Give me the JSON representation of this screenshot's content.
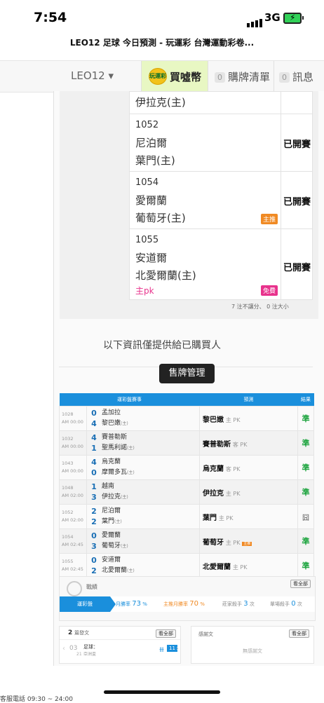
{
  "status": {
    "time": "7:54",
    "network": "3G"
  },
  "browser": {
    "title": "LEO12 足球 今日預測 - 玩運彩 台灣運動彩卷..."
  },
  "nav": {
    "user": "LEO12 ▾",
    "coin_icon_text": "玩運彩",
    "buy": "買噓幣",
    "cart_count": "0",
    "cart": "購牌清單",
    "msg_count": "0",
    "msg": "訊息"
  },
  "picks": {
    "top_partial": "伊拉克(主)",
    "rows": [
      {
        "no": "1052",
        "away": "尼泊爾",
        "home": "葉門(主)",
        "result": "已開賽",
        "extra": "",
        "tag": ""
      },
      {
        "no": "1054",
        "away": "愛爾蘭",
        "home": "葡萄牙(主)",
        "result": "已開賽",
        "extra": "",
        "tag": "主推"
      },
      {
        "no": "1055",
        "away": "安道爾",
        "home": "北愛爾蘭(主)",
        "result": "已開賽",
        "extra": "主pk",
        "tag": "免費"
      }
    ],
    "note": "7 注不讓分、 0 注大小"
  },
  "info_text": "以下資訊僅提供給已購買人",
  "manage_button": "售牌管理",
  "record": {
    "headers": [
      "運彩盤賽事",
      "預測",
      "結果"
    ],
    "rows": [
      {
        "no": "1028",
        "time": "AM 00:00",
        "s1": "0",
        "s2": "4",
        "t1": "孟加拉",
        "t2": "黎巴嫩",
        "home": "(主)",
        "pick": "黎巴嫩",
        "mk": "主 PK",
        "res": "準"
      },
      {
        "no": "1032",
        "time": "AM 00:00",
        "s1": "4",
        "s2": "1",
        "t1": "賽普勒斯",
        "t2": "聖馬利諾",
        "home": "(主)",
        "pick": "賽普勒斯",
        "mk": "客 PK",
        "res": "準"
      },
      {
        "no": "1043",
        "time": "AM 00:00",
        "s1": "4",
        "s2": "0",
        "t1": "烏克蘭",
        "t2": "摩爾多瓦",
        "home": "(主)",
        "pick": "烏克蘭",
        "mk": "客 PK",
        "res": "準"
      },
      {
        "no": "1048",
        "time": "AM 02:00",
        "s1": "1",
        "s2": "3",
        "t1": "越南",
        "t2": "伊拉克",
        "home": "(主)",
        "pick": "伊拉克",
        "mk": "主 PK",
        "res": "準"
      },
      {
        "no": "1052",
        "time": "AM 02:00",
        "s1": "2",
        "s2": "2",
        "t1": "尼泊爾",
        "t2": "葉門",
        "home": "(主)",
        "pick": "葉門",
        "mk": "主 PK",
        "res": "囧"
      },
      {
        "no": "1054",
        "time": "AM 02:45",
        "s1": "0",
        "s2": "3",
        "t1": "愛爾蘭",
        "t2": "葡萄牙",
        "home": "(主)",
        "pick": "葡萄牙",
        "mk": "主 PK",
        "res": "準"
      },
      {
        "no": "1055",
        "time": "AM 02:45",
        "s1": "0",
        "s2": "2",
        "t1": "安道爾",
        "t2": "北愛爾蘭",
        "home": "(主)",
        "pick": "北愛爾蘭",
        "mk": "主 PK",
        "res": "準"
      }
    ]
  },
  "stats": {
    "title": "戰績",
    "view_all": "看全部",
    "tab_active": "運彩盤",
    "monthly_label": "月勝率",
    "monthly_value": "73",
    "main_label": "主推月勝率",
    "main_value": "70",
    "streak_label": "莊家殺手",
    "streak_value": "3",
    "streak_unit": "次",
    "single_label": "單場殺手",
    "single_value": "0",
    "single_unit": "次",
    "percent": "%"
  },
  "posts": {
    "count": "2",
    "label": "篇發文",
    "view_all": "看全部",
    "date_day": "03",
    "date_sub": "21",
    "post_title": "足球：",
    "post_sub": "亞洲盃",
    "badge": "11",
    "badge_prefix": "卌"
  },
  "thanks": {
    "label": "感謝文",
    "view_all": "看全部",
    "empty": "無感謝文"
  },
  "footer": {
    "text": "客服電話 09:30 ~ 24:00"
  },
  "colors": {
    "accent": "#1a8fdc",
    "win": "#1aa33c",
    "main_tag": "#f08a24",
    "free_tag": "#e8328c"
  }
}
